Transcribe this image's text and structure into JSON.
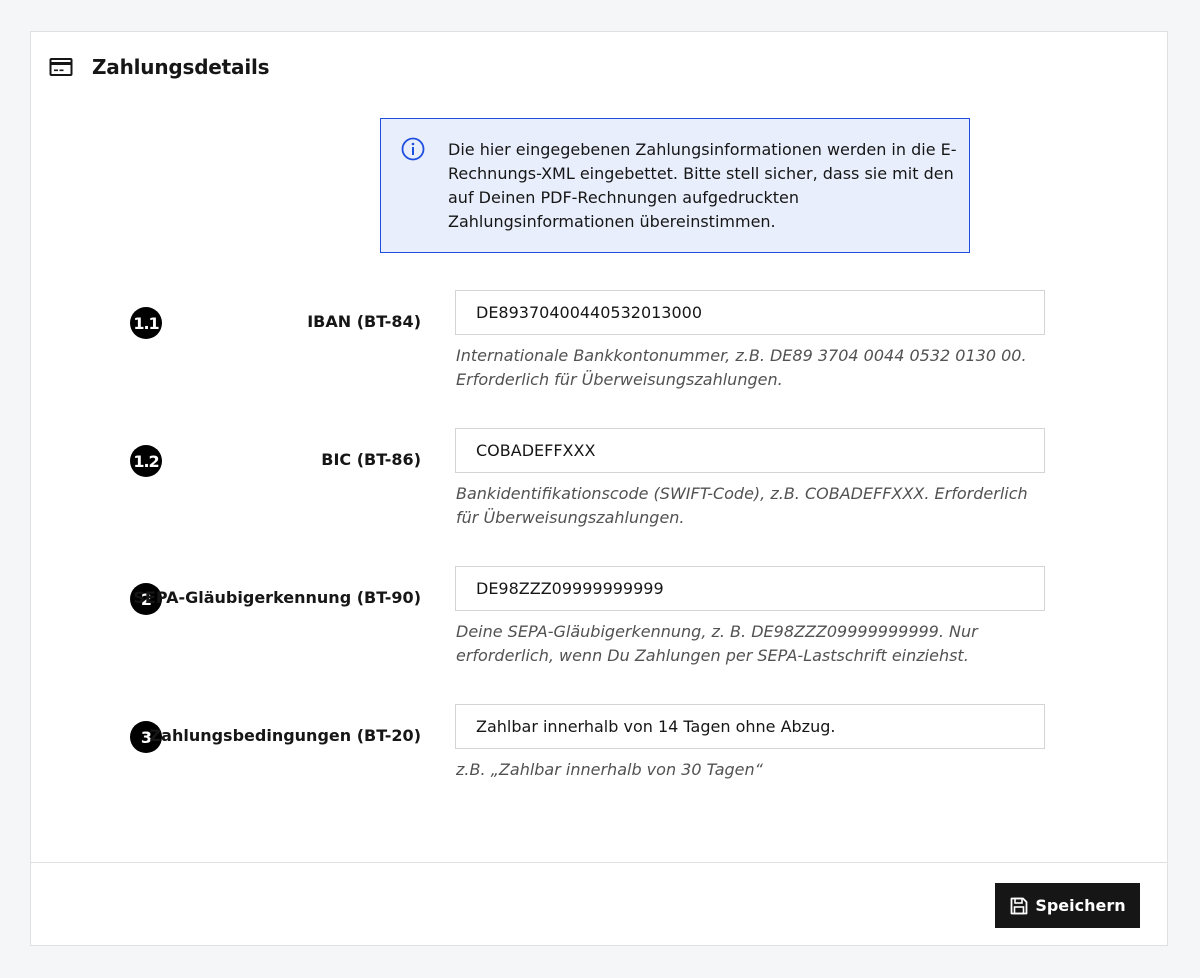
{
  "header": {
    "title": "Zahlungsdetails",
    "icon": "credit-card-icon"
  },
  "notice": {
    "icon": "info-icon",
    "text": "Die hier eingegebenen Zahlungsinformationen werden in die E-Rechnungs-XML eingebettet. Bitte stell sicher, dass sie mit den auf Deinen PDF-Rechnungen aufgedruckten Zahlungsinformationen übereinstimmen.",
    "accent": "#1f4fe0",
    "background": "#e8eefb"
  },
  "fields": [
    {
      "badge": "1.1",
      "label": "IBAN (BT-84)",
      "value": "DE89370400440532013000",
      "help": "Internationale Bankkontonummer, z.B. DE89 3704 0044 0532 0130 00. Erforderlich für Überweisungszahlungen."
    },
    {
      "badge": "1.2",
      "label": "BIC (BT-86)",
      "value": "COBADEFFXXX",
      "help": "Bankidentifikationscode (SWIFT-Code), z.B. COBADEFFXXX. Erforderlich für Überweisungszahlungen."
    },
    {
      "badge": "2",
      "label": "SEPA-Gläubigerkennung (BT-90)",
      "value": "DE98ZZZ09999999999",
      "help": "Deine SEPA-Gläubigerkennung, z. B. DE98ZZZ09999999999. Nur erforderlich, wenn Du Zahlungen per SEPA-Lastschrift einziehst."
    },
    {
      "badge": "3",
      "label": "Zahlungsbedingungen (BT-20)",
      "value": "Zahlbar innerhalb von 14 Tagen ohne Abzug.",
      "help": "z.B. „Zahlbar innerhalb von 30 Tagen“"
    }
  ],
  "footer": {
    "save_label": "Speichern",
    "save_icon": "floppy-disk-icon",
    "button_color": "#161616"
  }
}
